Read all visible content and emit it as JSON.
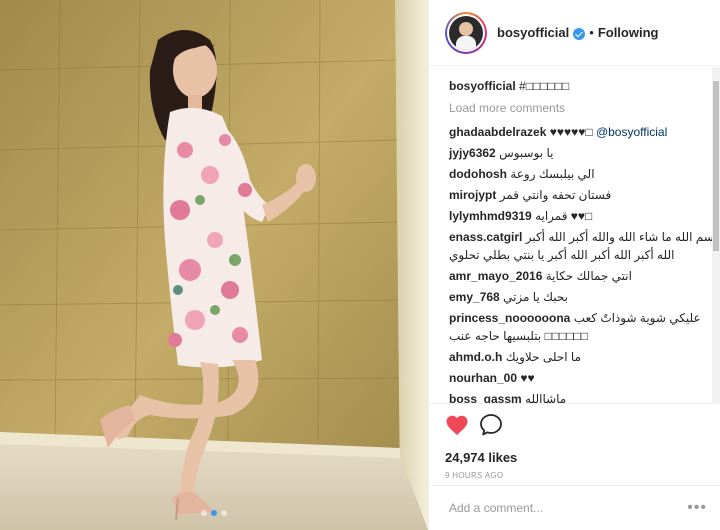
{
  "post": {
    "author": "bosyofficial",
    "follow_separator": "•",
    "follow_status": "Following",
    "caption_user": "bosyofficial",
    "caption_text": "#□□□□□□",
    "load_more": "Load more comments",
    "likes": "24,974 likes",
    "timestamp": "9 HOURS AGO",
    "add_comment_placeholder": "Add a comment...",
    "more_options": "•••",
    "carousel_count": 3,
    "carousel_active": 1
  },
  "comments": [
    {
      "user": "ghadaabdelrazek",
      "text": "♥♥♥♥♥□",
      "mention": "@bosyofficial"
    },
    {
      "user": "jyjy6362",
      "text": "يا بوسبوس"
    },
    {
      "user": "dodohosh",
      "text": "الي بيلبسك روعة"
    },
    {
      "user": "mirojypt",
      "text": "فستان تحفه وانتي قمر"
    },
    {
      "user": "lylymhmd9319",
      "text": "قمرايه ♥♥□"
    },
    {
      "user": "enass.catgirl",
      "text": "بسم الله ما شاء الله والله أكبر الله أكبر",
      "text2": "الله أكبر الله أكبر الله أكبر يا بنتي بطلي تحلوي"
    },
    {
      "user": "amr_mayo_2016",
      "text": "انتي جمالك حكاية"
    },
    {
      "user": "emy_768",
      "text": "بحبك يا مزتي"
    },
    {
      "user": "princess_noooooona",
      "text": "عليكي شوية شوذاتٌ كعب",
      "text2": "بتلبسيها حاجه عنب □□□□□□"
    },
    {
      "user": "ahmd.o.h",
      "text": "ما احلى حلاويك"
    },
    {
      "user": "nourhan_00",
      "text": "♥♥"
    },
    {
      "user": "boss_gassm",
      "text": "ماشاالله"
    }
  ],
  "colors": {
    "accent": "#3897f0",
    "heart": "#ed4956",
    "text": "#262626",
    "muted": "#999999"
  },
  "icons": {
    "like": "heart-icon",
    "comment": "comment-bubble-icon",
    "verified": "verified-badge-icon"
  }
}
